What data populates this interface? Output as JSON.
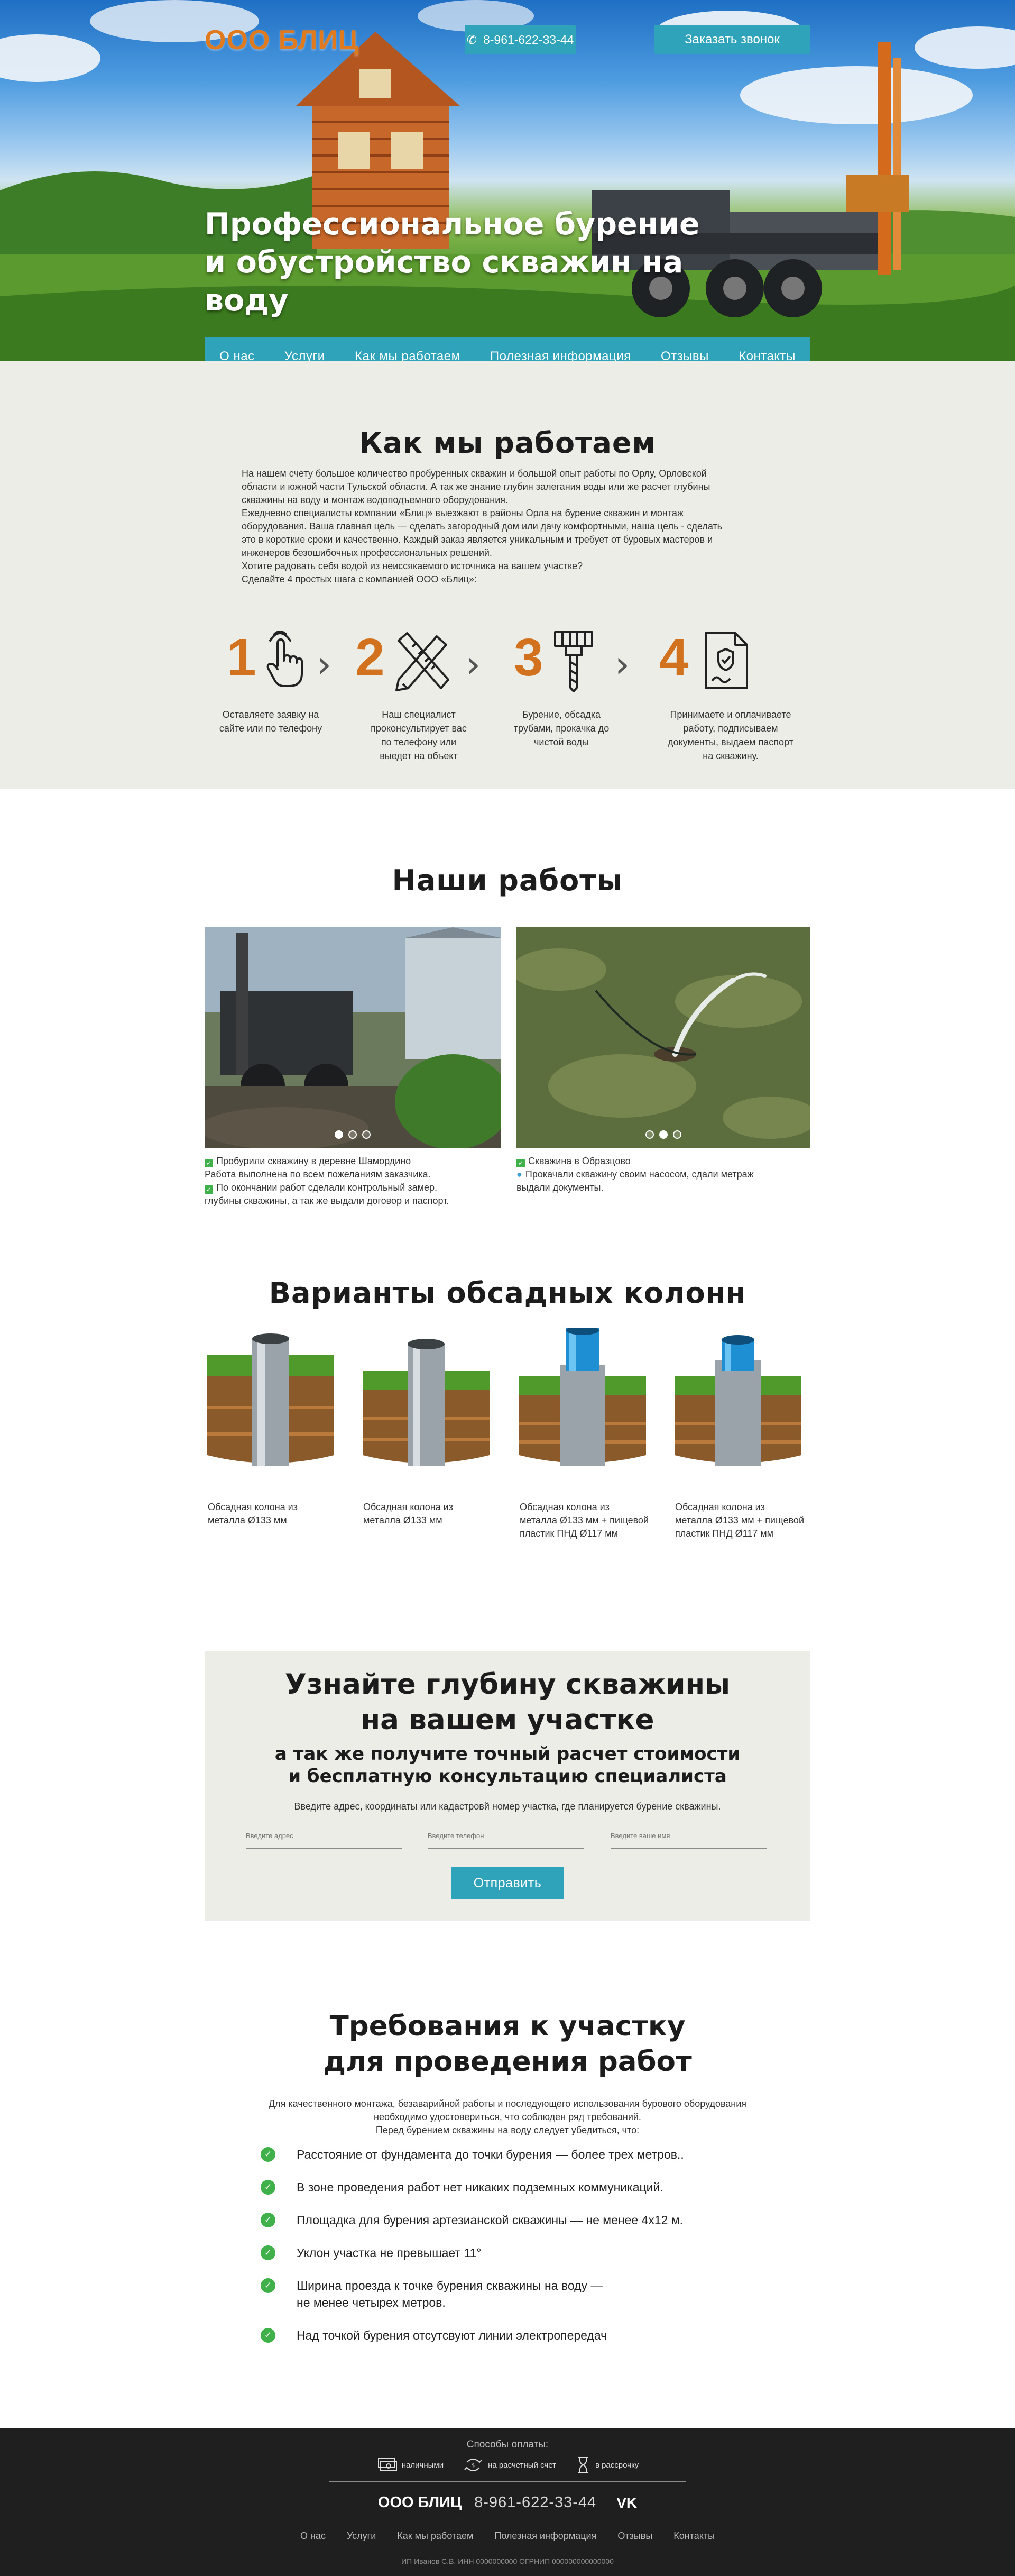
{
  "header": {
    "logo": "ООО БЛИЦ",
    "phone": "8-961-622-33-44",
    "call_button": "Заказать звонок",
    "hero_title": "Профессиональное бурение и обустройство скважин на воду"
  },
  "nav": {
    "items": [
      {
        "label": "О нас"
      },
      {
        "label": "Услуги"
      },
      {
        "label": "Как мы работаем"
      },
      {
        "label": "Полезная информация"
      },
      {
        "label": "Отзывы"
      },
      {
        "label": "Контакты"
      }
    ],
    "active": "Как мы работаем"
  },
  "how": {
    "title": "Как мы работаем",
    "intro": [
      "На нашем счету большое количество пробуренных скважин и большой опыт работы по Орлу, Орловской",
      "области и южной части Тульской области. А так же знание глубин залегания воды или же расчет глубины",
      "скважины на воду и монтаж водоподъемного оборудования.",
      "Ежедневно специалисты компании «Блиц» выезжают в районы Орла на бурение скважин и монтаж",
      "оборудования. Ваша главная цель — сделать загородный дом или дачу комфортными, наша цель - сделать",
      "это в короткие сроки и качественно. Каждый заказ является уникальным и требует от буровых мастеров и",
      "инженеров безошибочных профессиональных решений.",
      "Хотите радовать себя водой из неиссякаемого источника на вашем участке?",
      "Сделайте 4 простых шага с компанией ООО «Блиц»:"
    ],
    "steps": [
      {
        "num": "1",
        "icon": "tap-hand-icon",
        "text": "Оставляете заявку на сайте или по телефону"
      },
      {
        "num": "2",
        "icon": "pencil-ruler-icon",
        "text": "Наш специалист проконсультирует вас по телефону или выедет на объект"
      },
      {
        "num": "3",
        "icon": "drill-icon",
        "text": "Бурение, обсадка трубами, прокачка до чистой воды"
      },
      {
        "num": "4",
        "icon": "signed-document-icon",
        "text": "Принимаете и оплачиваете работу, подписываем документы, выдаем паспорт на скважину."
      }
    ]
  },
  "works": {
    "title": "Наши работы",
    "items": [
      {
        "lines": [
          "Пробурили скважину в деревне Шамордино",
          "Работа выполнена по всем пожеланиям заказчика.",
          "По окончании работ сделали контрольный замер.",
          "глубины скважины, а так же выдали договор и паспорт."
        ]
      },
      {
        "lines": [
          "Скважина в Образцово",
          "Прокачали скважину своим насосом, сдали метраж",
          "выдали документы."
        ]
      }
    ]
  },
  "casing": {
    "title": "Варианты обсадных колонн",
    "items": [
      {
        "text": "Обсадная колона из металла Ø133 мм"
      },
      {
        "text": "Обсадная колона из металла Ø133 мм"
      },
      {
        "text": "Обсадная колона из металла Ø133 мм + пищевой пластик ПНД Ø117 мм"
      },
      {
        "text": "Обсадная колона из металла Ø133 мм + пищевой пластик ПНД Ø117 мм"
      }
    ]
  },
  "depth": {
    "title_line1": "Узнайте глубину скважины",
    "title_line2": "на вашем участке",
    "subtitle_line1": "а так же получите точный расчет стоимости",
    "subtitle_line2": "и бесплатную консультацию специалиста",
    "text": "Введите адрес, координаты или кадастровй номер участка, где планируется бурение скважины.",
    "fields": [
      {
        "placeholder": "Введите адрес"
      },
      {
        "placeholder": "Введите телефон"
      },
      {
        "placeholder": "Введите ваше имя"
      }
    ],
    "submit": "Отправить"
  },
  "requirements": {
    "title_line1": "Требования к участку",
    "title_line2": "для проведения работ",
    "text": [
      "Для качественного монтажа, безаварийной работы и последующего использования бурового оборудования",
      "необходимо удостовериться, что соблюден ряд требований.",
      "Перед бурением скважины на воду следует убедиться, что:"
    ],
    "items": [
      {
        "text": "Расстояние от фундамента до точки бурения — более трех метров.."
      },
      {
        "text": "В зоне проведения работ нет никаких подземных коммуникаций."
      },
      {
        "text": "Площадка для бурения артезианской скважины — не менее 4х12 м."
      },
      {
        "text": "Уклон участка не превышает 11°"
      },
      {
        "text": "Ширина проезда к точке бурения скважины на воду —",
        "text2": "не менее четырех метров."
      },
      {
        "text": "Над точкой бурения отсутсвуют линии электропередач"
      }
    ]
  },
  "footer": {
    "payment_title": "Способы оплаты:",
    "payments": [
      {
        "icon": "cash-icon",
        "label": "наличными"
      },
      {
        "icon": "transfer-icon",
        "label": "на расчетный счет"
      },
      {
        "icon": "hourglass-icon",
        "label": "в рассрочку"
      }
    ],
    "logo": "ООО БЛИЦ",
    "phone": "8-961-622-33-44",
    "vk": "VK",
    "nav": [
      "О нас",
      "Услуги",
      "Как мы работаем",
      "Полезная информация",
      "Отзывы",
      "Контакты"
    ],
    "legal": "ИП Иванов С.В. ИНН 0000000000 ОГРНИП 000000000000000"
  },
  "colors": {
    "accent": "#2fa3b9",
    "brand_orange": "#d3721e",
    "section_bg": "#edede7",
    "footer_bg": "#1f1f1f",
    "check_green": "#3fb04a"
  }
}
